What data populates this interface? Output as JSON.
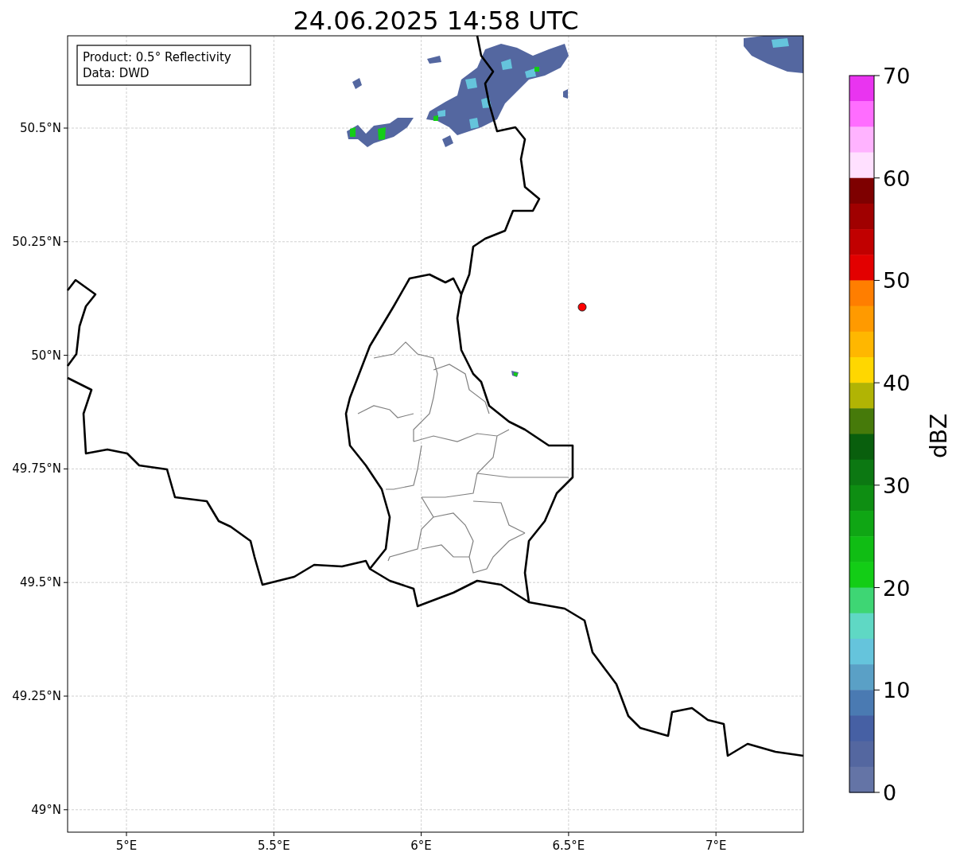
{
  "title": "24.06.2025 14:58 UTC",
  "legend": {
    "lines": [
      "Product: 0.5° Reflectivity",
      "Data: DWD"
    ]
  },
  "map": {
    "x_ticks": [
      "5°E",
      "5.5°E",
      "6°E",
      "6.5°E",
      "7°E"
    ],
    "y_ticks": [
      "50.5°N",
      "50.25°N",
      "50°N",
      "49.75°N",
      "49.5°N",
      "49.25°N",
      "49°N"
    ]
  },
  "colorbar": {
    "label": "dBZ",
    "ticks": [
      "70",
      "60",
      "50",
      "40",
      "30",
      "20",
      "10",
      "0"
    ],
    "segments": [
      {
        "color": "#e934f0"
      },
      {
        "color": "#ff6dff"
      },
      {
        "color": "#ffb3ff"
      },
      {
        "color": "#ffe0ff"
      },
      {
        "color": "#7e0000"
      },
      {
        "color": "#a00000"
      },
      {
        "color": "#c10000"
      },
      {
        "color": "#e30000"
      },
      {
        "color": "#ff7e00"
      },
      {
        "color": "#ff9a00"
      },
      {
        "color": "#ffb700"
      },
      {
        "color": "#ffd700"
      },
      {
        "color": "#b1b404"
      },
      {
        "color": "#467a0a"
      },
      {
        "color": "#095f0d"
      },
      {
        "color": "#0c7812"
      },
      {
        "color": "#0e8e12"
      },
      {
        "color": "#0fa614"
      },
      {
        "color": "#10bd14"
      },
      {
        "color": "#13cd16"
      },
      {
        "color": "#3ed674"
      },
      {
        "color": "#5fd8c4"
      },
      {
        "color": "#65c4dc"
      },
      {
        "color": "#5aa0c6"
      },
      {
        "color": "#4a7ab2"
      },
      {
        "color": "#4660a4"
      },
      {
        "color": "#5467a0"
      },
      {
        "color": "#6474a6"
      }
    ]
  }
}
